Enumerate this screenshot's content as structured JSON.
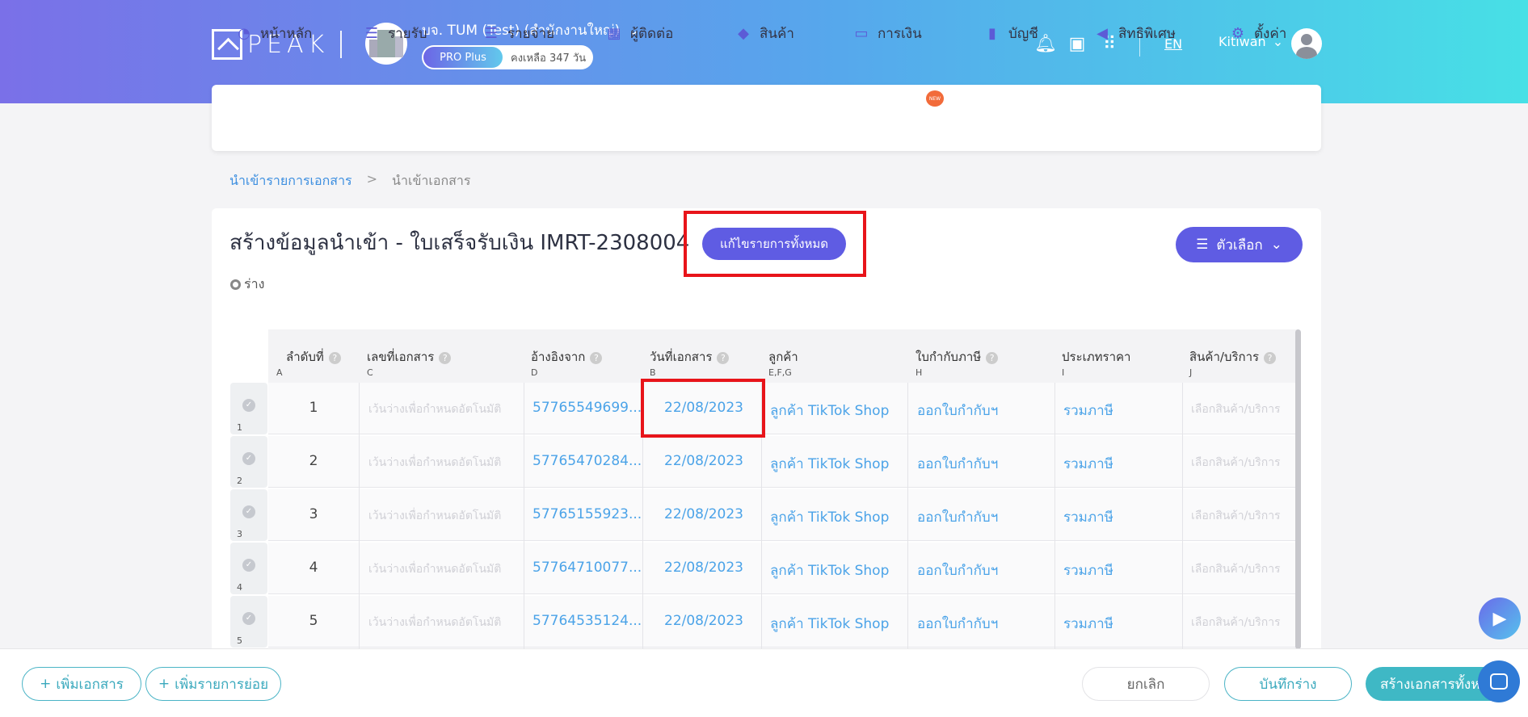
{
  "header": {
    "logo_text": "PEAK",
    "company_name": "บจ. TUM (Test) (สำนักงานใหญ่)",
    "plan_badge": "PRO Plus",
    "plan_remaining": "คงเหลือ 347 วัน",
    "language": "EN",
    "user_name": "Kitiwan",
    "icons": [
      "bell-icon",
      "book-icon",
      "apps-grid-icon"
    ]
  },
  "nav": {
    "items": [
      {
        "label": "หน้าหลัก",
        "icon": "dashboard-icon"
      },
      {
        "label": "รายรับ",
        "icon": "income-icon"
      },
      {
        "label": "รายจ่าย",
        "icon": "expense-icon"
      },
      {
        "label": "ผู้ติดต่อ",
        "icon": "contacts-icon"
      },
      {
        "label": "สินค้า",
        "icon": "box-icon"
      },
      {
        "label": "การเงิน",
        "icon": "money-icon"
      },
      {
        "label": "บัญชี",
        "icon": "ledger-icon"
      },
      {
        "label": "สิทธิพิเศษ",
        "icon": "megaphone-icon"
      },
      {
        "label": "ตั้งค่า",
        "icon": "gear-icon"
      }
    ],
    "new_badge": "NEW"
  },
  "breadcrumb": {
    "parent": "นำเข้ารายการเอกสาร",
    "separator": ">",
    "current": "นำเข้าเอกสาร"
  },
  "page": {
    "title": "สร้างข้อมูลนำเข้า - ใบเสร็จรับเงิน IMRT-2308004",
    "edit_all_button": "แก้ไขรายการทั้งหมด",
    "status": "ร่าง",
    "options_button": "ตัวเลือก"
  },
  "table": {
    "columns": [
      {
        "label": "ลำดับที่",
        "letter": "A"
      },
      {
        "label": "เลขที่เอกสาร",
        "letter": "C"
      },
      {
        "label": "อ้างอิงจาก",
        "letter": "D"
      },
      {
        "label": "วันที่เอกสาร",
        "letter": "B"
      },
      {
        "label": "ลูกค้า",
        "letter": "E,F,G"
      },
      {
        "label": "ใบกำกับภาษี",
        "letter": "H"
      },
      {
        "label": "ประเภทราคา",
        "letter": "I"
      },
      {
        "label": "สินค้า/บริการ",
        "letter": "J"
      }
    ],
    "rows": [
      {
        "row_num": "1",
        "seq": "1",
        "doc_no": "เว้นว่างเพื่อกำหนดอัตโนมัติ",
        "ref": "57765549699...",
        "date": "22/08/2023",
        "customer": "ลูกค้า TikTok Shop",
        "tax_invoice": "ออกใบกำกับฯ",
        "price_type": "รวมภาษี",
        "product": "เลือกสินค้า/บริการ"
      },
      {
        "row_num": "2",
        "seq": "2",
        "doc_no": "เว้นว่างเพื่อกำหนดอัตโนมัติ",
        "ref": "57765470284...",
        "date": "22/08/2023",
        "customer": "ลูกค้า TikTok Shop",
        "tax_invoice": "ออกใบกำกับฯ",
        "price_type": "รวมภาษี",
        "product": "เลือกสินค้า/บริการ"
      },
      {
        "row_num": "3",
        "seq": "3",
        "doc_no": "เว้นว่างเพื่อกำหนดอัตโนมัติ",
        "ref": "57765155923...",
        "date": "22/08/2023",
        "customer": "ลูกค้า TikTok Shop",
        "tax_invoice": "ออกใบกำกับฯ",
        "price_type": "รวมภาษี",
        "product": "เลือกสินค้า/บริการ"
      },
      {
        "row_num": "4",
        "seq": "4",
        "doc_no": "เว้นว่างเพื่อกำหนดอัตโนมัติ",
        "ref": "57764710077...",
        "date": "22/08/2023",
        "customer": "ลูกค้า TikTok Shop",
        "tax_invoice": "ออกใบกำกับฯ",
        "price_type": "รวมภาษี",
        "product": "เลือกสินค้า/บริการ"
      },
      {
        "row_num": "5",
        "seq": "5",
        "doc_no": "เว้นว่างเพื่อกำหนดอัตโนมัติ",
        "ref": "57764535124...",
        "date": "22/08/2023",
        "customer": "ลูกค้า TikTok Shop",
        "tax_invoice": "ออกใบกำกับฯ",
        "price_type": "รวมภาษี",
        "product": "เลือกสินค้า/บริการ"
      }
    ]
  },
  "footer": {
    "add_document": "เพิ่มเอกสาร",
    "add_sub_item": "เพิ่มรายการย่อย",
    "cancel": "ยกเลิก",
    "save_draft": "บันทึกร่าง",
    "create_all": "สร้างเอกสารทั้งหมด"
  },
  "colors": {
    "primary": "#5f5ce3",
    "teal": "#3fb8c5",
    "link_blue": "#4ba3e8",
    "highlight_red": "#e8141a"
  }
}
